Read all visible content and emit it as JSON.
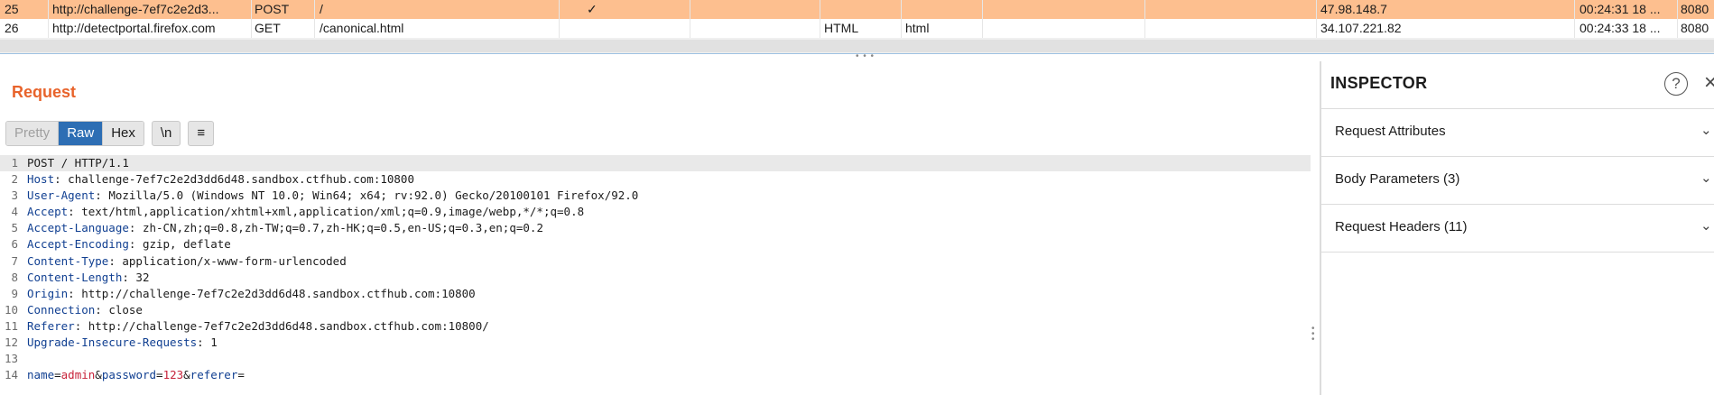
{
  "history": {
    "rows": [
      {
        "num": "25",
        "host": "http://challenge-7ef7c2e2d3...",
        "method": "POST",
        "url": "/",
        "edited": "✓",
        "mime": "",
        "ext": "",
        "ip": "47.98.148.7",
        "time": "00:24:31 18 ...",
        "port": "8080",
        "selected": true
      },
      {
        "num": "26",
        "host": "http://detectportal.firefox.com",
        "method": "GET",
        "url": "/canonical.html",
        "edited": "",
        "mime": "HTML",
        "ext": "html",
        "ip": "34.107.221.82",
        "time": "00:24:33 18 ...",
        "port": "8080",
        "selected": false
      }
    ],
    "selected_color": "#fdbf8f"
  },
  "request": {
    "title": "Request",
    "tabs": {
      "pretty": "Pretty",
      "raw": "Raw",
      "hex": "Hex",
      "newline": "\\n",
      "menu": "≡"
    },
    "active_tab": "Raw",
    "lines": [
      {
        "n": "1",
        "text": "POST / HTTP/1.1"
      },
      {
        "n": "2",
        "name": "Host",
        "value": "challenge-7ef7c2e2d3dd6d48.sandbox.ctfhub.com:10800"
      },
      {
        "n": "3",
        "name": "User-Agent",
        "value": "Mozilla/5.0 (Windows NT 10.0; Win64; x64; rv:92.0) Gecko/20100101 Firefox/92.0"
      },
      {
        "n": "4",
        "name": "Accept",
        "value": "text/html,application/xhtml+xml,application/xml;q=0.9,image/webp,*/*;q=0.8"
      },
      {
        "n": "5",
        "name": "Accept-Language",
        "value": "zh-CN,zh;q=0.8,zh-TW;q=0.7,zh-HK;q=0.5,en-US;q=0.3,en;q=0.2"
      },
      {
        "n": "6",
        "name": "Accept-Encoding",
        "value": "gzip, deflate"
      },
      {
        "n": "7",
        "name": "Content-Type",
        "value": "application/x-www-form-urlencoded"
      },
      {
        "n": "8",
        "name": "Content-Length",
        "value": "32"
      },
      {
        "n": "9",
        "name": "Origin",
        "value": "http://challenge-7ef7c2e2d3dd6d48.sandbox.ctfhub.com:10800"
      },
      {
        "n": "10",
        "name": "Connection",
        "value": "close"
      },
      {
        "n": "11",
        "name": "Referer",
        "value": "http://challenge-7ef7c2e2d3dd6d48.sandbox.ctfhub.com:10800/"
      },
      {
        "n": "12",
        "name": "Upgrade-Insecure-Requests",
        "value": "1"
      },
      {
        "n": "13",
        "text": ""
      }
    ],
    "body": {
      "n": "14",
      "params": [
        {
          "k": "name",
          "v": "admin"
        },
        {
          "k": "password",
          "v": "123"
        },
        {
          "k": "referer",
          "v": ""
        }
      ]
    }
  },
  "inspector": {
    "title": "INSPECTOR",
    "help_icon": "?",
    "close_icon": "×",
    "sections": [
      {
        "label": "Request Attributes"
      },
      {
        "label": "Body Parameters (3)"
      },
      {
        "label": "Request Headers (11)"
      }
    ]
  },
  "colors": {
    "accent": "#e8632b",
    "header_name": "#103f91",
    "param_value": "#c7233a",
    "raw_tab": "#2d6eb4"
  }
}
